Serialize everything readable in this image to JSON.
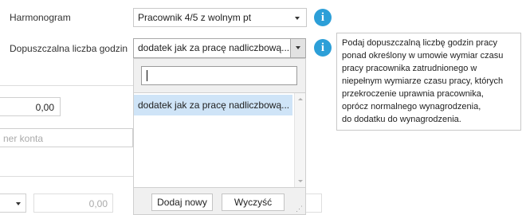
{
  "form": {
    "harmonogram_label": "Harmonogram",
    "harmonogram_value": "Pracownik 4/5 z wolnym pt",
    "hours_label": "Dopuszczalna liczba godzin",
    "hours_value": "dodatek jak za pracę nadliczbową...",
    "amount_value": "0,00",
    "account_placeholder": "ner konta",
    "bottom_amount_value": "0,00"
  },
  "tooltip": {
    "lines": [
      "Podaj dopuszczalną liczbę godzin pracy",
      "ponad określony w umowie wymiar czasu",
      "pracy pracownika zatrudnionego w",
      "niepełnym wymiarze czasu pracy, których",
      "przekroczenie uprawnia pracownika,",
      "oprócz normalnego wynagrodzenia,",
      "do dodatku do wynagrodzenia."
    ]
  },
  "dropdown": {
    "search_value": "",
    "items": [
      "dodatek jak za pracę nadliczbową..."
    ],
    "add_new_label": "Dodaj nowy",
    "clear_label": "Wyczyść"
  },
  "colors": {
    "accent": "#2c9fd8",
    "selected_row": "#cfe4f7"
  }
}
